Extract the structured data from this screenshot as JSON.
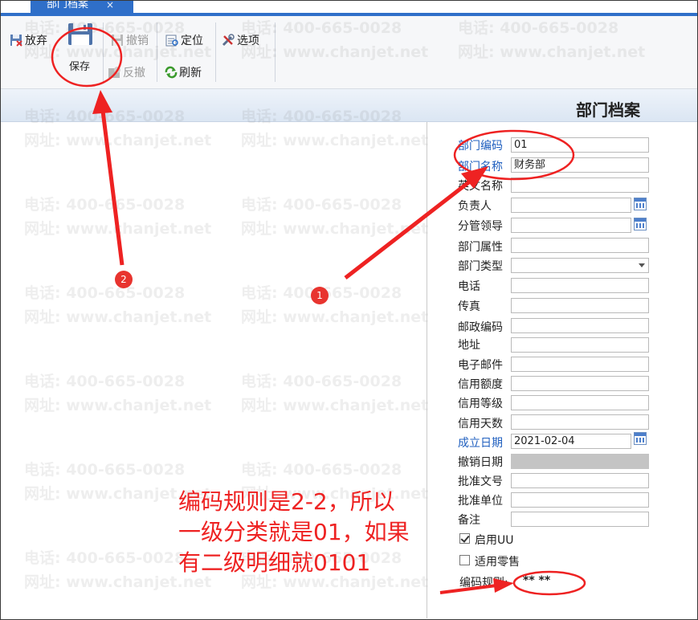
{
  "tab": {
    "label": "部门档案",
    "close": "×"
  },
  "toolbar": {
    "discard": "放弃",
    "save": "保存",
    "undo": "撤销",
    "unrevoke": "反撤",
    "locate": "定位",
    "refresh": "刷新",
    "options": "选项"
  },
  "page_title": "部门档案",
  "form": {
    "dept_code": {
      "label": "部门编码",
      "value": "01"
    },
    "dept_name": {
      "label": "部门名称",
      "value": "财务部"
    },
    "english_name": {
      "label": "英文名称",
      "value": ""
    },
    "manager": {
      "label": "负责人",
      "value": ""
    },
    "supervisor": {
      "label": "分管领导",
      "value": ""
    },
    "dept_attr": {
      "label": "部门属性",
      "value": ""
    },
    "dept_type": {
      "label": "部门类型",
      "value": ""
    },
    "phone": {
      "label": "电话",
      "value": ""
    },
    "fax": {
      "label": "传真",
      "value": ""
    },
    "postcode": {
      "label": "邮政编码",
      "value": ""
    },
    "address": {
      "label": "地址",
      "value": ""
    },
    "email": {
      "label": "电子邮件",
      "value": ""
    },
    "credit_limit": {
      "label": "信用额度",
      "value": ""
    },
    "credit_level": {
      "label": "信用等级",
      "value": ""
    },
    "credit_days": {
      "label": "信用天数",
      "value": ""
    },
    "established": {
      "label": "成立日期",
      "value": "2021-02-04"
    },
    "revoked": {
      "label": "撤销日期",
      "value": ""
    },
    "approval_doc": {
      "label": "批准文号",
      "value": ""
    },
    "approval_unit": {
      "label": "批准单位",
      "value": ""
    },
    "remark": {
      "label": "备注",
      "value": ""
    },
    "enable_uu": {
      "label": "启用UU",
      "checked": true
    },
    "retail": {
      "label": "适用零售",
      "checked": false
    },
    "code_rule": {
      "label": "编码规则:",
      "value": "** **"
    }
  },
  "annotation": {
    "line1": "编码规则是2-2，所以",
    "line2": "一级分类就是01，如果",
    "line3": "有二级明细就0101",
    "badge1": "1",
    "badge2": "2"
  },
  "watermark": {
    "phone": "电话: 400-665-0028",
    "site": "网址: www.chanjet.net"
  },
  "colors": {
    "accent": "#2f6fc9",
    "required_label": "#1f5fbf",
    "annotation": "#ee2222"
  }
}
